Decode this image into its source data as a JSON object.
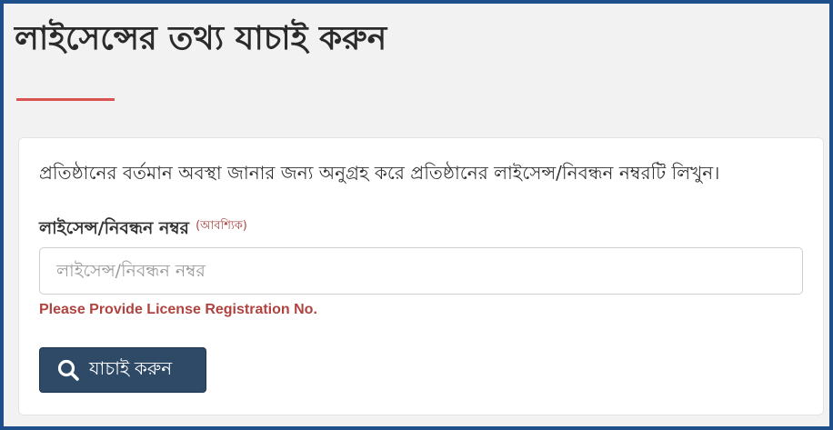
{
  "page": {
    "title": "লাইসেন্সের তথ্য যাচাই করুন"
  },
  "form": {
    "instruction": "প্রতিষ্ঠানের বর্তমান অবস্থা জানার জন্য অনুগ্রহ করে প্রতিষ্ঠানের লাইসেন্স/নিবন্ধন নম্বরটি লিখুন।",
    "field_label": "লাইসেন্স/নিবন্ধন নম্বর",
    "required_text": "(আবশ্যিক)",
    "input_value": "",
    "input_placeholder": "লাইসেন্স/নিবন্ধন নম্বর",
    "error_message": "Please Provide License Registration No.",
    "submit_label": "যাচাই করুন",
    "submit_icon": "search-icon"
  },
  "colors": {
    "frame_border": "#1f4f8b",
    "accent_underline": "#d9534f",
    "button_bg": "#2e4a66",
    "error": "#b0433f"
  }
}
